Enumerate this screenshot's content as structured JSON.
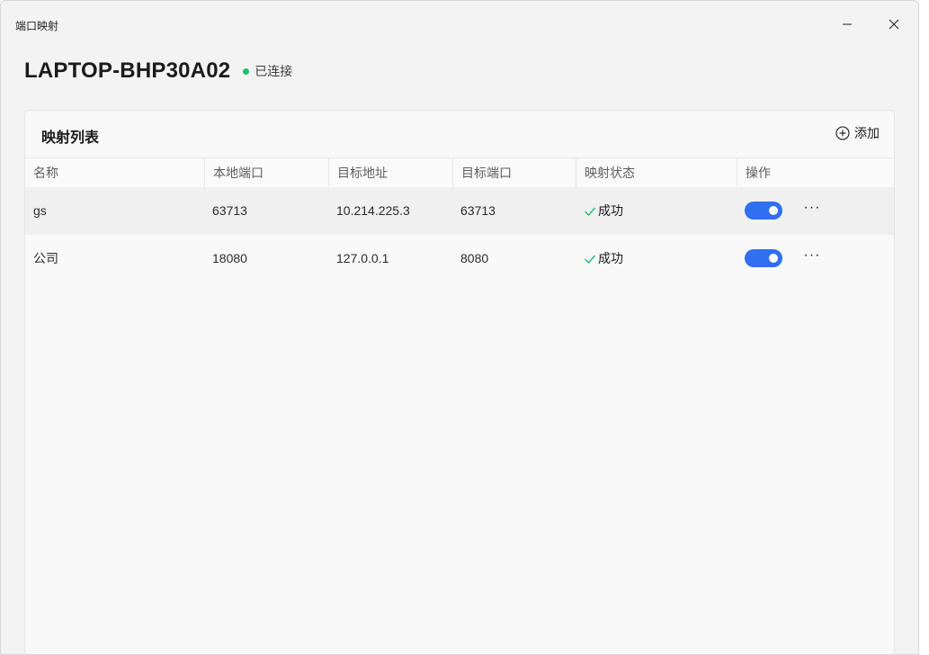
{
  "window": {
    "title": "端口映射"
  },
  "device": {
    "name": "LAPTOP-BHP30A02",
    "status": "已连接",
    "status_color": "#1ec26b"
  },
  "card": {
    "title": "映射列表",
    "add_label": "添加"
  },
  "table": {
    "headers": [
      "名称",
      "本地端口",
      "目标地址",
      "目标端口",
      "映射状态",
      "操作"
    ],
    "rows": [
      {
        "name": "gs",
        "local_port": "63713",
        "target_addr": "10.214.225.3",
        "target_port": "63713",
        "status": "成功",
        "enabled": true,
        "more": "···"
      },
      {
        "name": "公司",
        "local_port": "18080",
        "target_addr": "127.0.0.1",
        "target_port": "8080",
        "status": "成功",
        "enabled": true,
        "more": "···"
      }
    ]
  },
  "colors": {
    "accent": "#2f6ff0",
    "success": "#1ec26b"
  },
  "icons": {
    "minimize": "minimize-icon",
    "close": "close-icon",
    "add": "plus-circle-icon",
    "check": "check-icon",
    "more": "more-horizontal-icon"
  }
}
